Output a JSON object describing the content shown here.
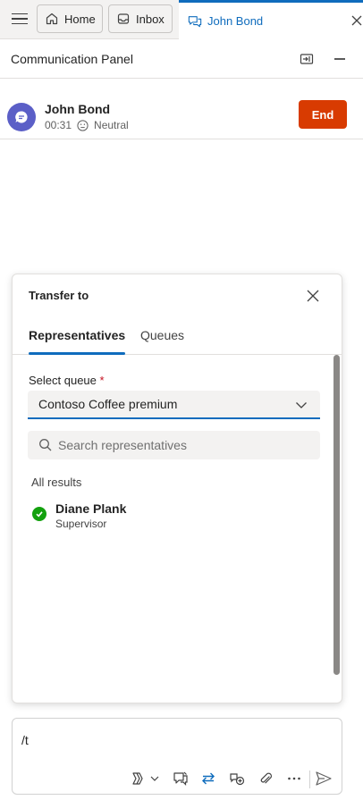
{
  "tabs": {
    "home": "Home",
    "inbox": "Inbox",
    "active": "John Bond"
  },
  "panel": {
    "title": "Communication Panel"
  },
  "session": {
    "customer_name": "John Bond",
    "duration": "00:31",
    "sentiment": "Neutral",
    "end_label": "End"
  },
  "transfer": {
    "title": "Transfer to",
    "tabs": [
      "Representatives",
      "Queues"
    ],
    "queue_label": "Select queue",
    "queue_required_mark": "*",
    "queue_value": "Contoso Coffee premium",
    "search_placeholder": "Search representatives",
    "results_heading": "All results",
    "representatives": [
      {
        "name": "Diane Plank",
        "role": "Supervisor",
        "status": "available"
      }
    ]
  },
  "composer": {
    "text": "/t"
  },
  "colors": {
    "accent": "#0f6cbd",
    "end_button": "#d83b01",
    "available": "#13a10e",
    "avatar": "#5b5fc7"
  },
  "icons": [
    "menu-icon",
    "home-icon",
    "inbox-icon",
    "chat-icon",
    "close-icon",
    "popout-icon",
    "minimize-icon",
    "chat-bubble-icon",
    "neutral-face-icon",
    "chevron-down-icon",
    "search-icon",
    "check-icon",
    "copilot-icon",
    "quick-reply-icon",
    "transfer-icon",
    "consult-icon",
    "attach-icon",
    "more-icon",
    "send-icon"
  ]
}
